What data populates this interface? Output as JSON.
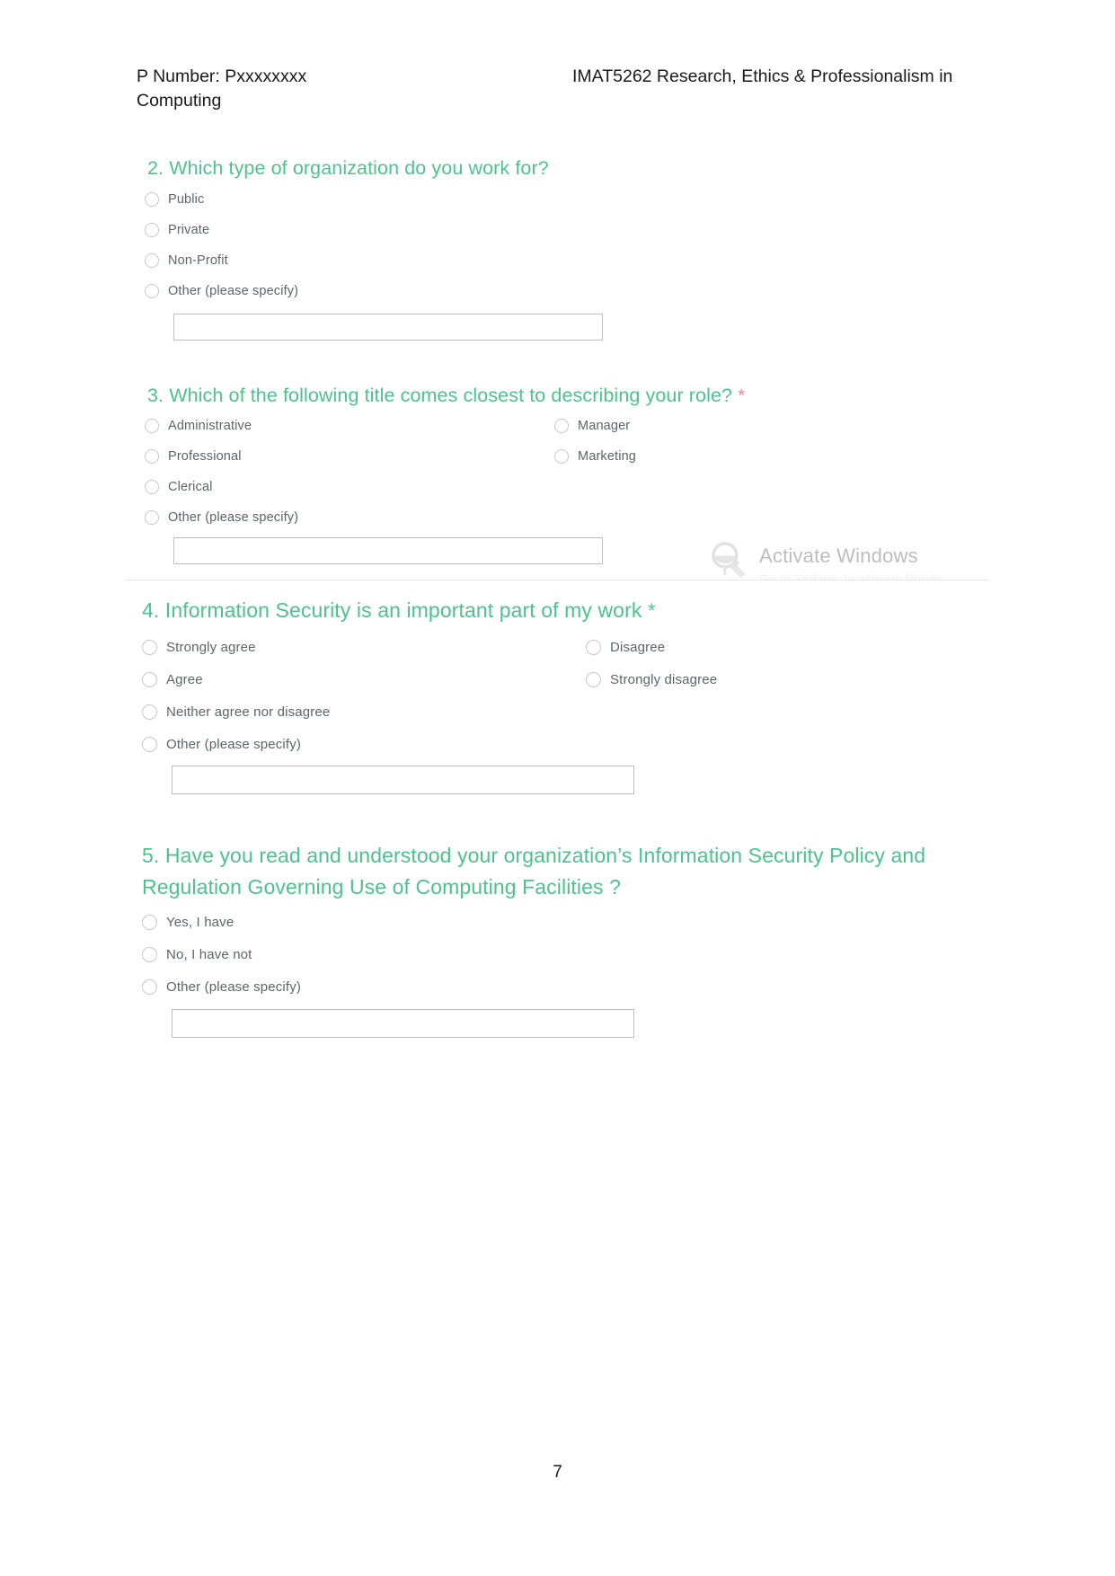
{
  "header": {
    "left": "P Number: Pxxxxxxxx",
    "right": "IMAT5262 Research, Ethics & Professionalism in",
    "wrap": "Computing"
  },
  "questions": [
    {
      "id": "q2",
      "title": "2. Which type of organization do you work for?",
      "required": false,
      "required_mark": "",
      "options_col1": [
        "Public",
        "Private",
        "Non-Profit"
      ],
      "options_col2": [],
      "other_label": "Other (please specify)",
      "other_value": "",
      "other_placeholder": ""
    },
    {
      "id": "q3",
      "title": "3. Which of the following title comes closest to describing your role?",
      "required": true,
      "required_mark": "*",
      "options_col1": [
        "Administrative",
        "Professional",
        "Clerical"
      ],
      "options_col2": [
        "Manager",
        "Marketing"
      ],
      "other_label": "Other (please specify)",
      "other_value": "",
      "other_placeholder": ""
    },
    {
      "id": "q4",
      "title": "4. Information Security is an important part of my work",
      "required": true,
      "required_mark": "*",
      "options_col1": [
        "Strongly agree",
        "Agree",
        "Neither agree nor disagree"
      ],
      "options_col2": [
        "Disagree",
        "Strongly disagree"
      ],
      "other_label": "Other (please specify)",
      "other_value": "",
      "other_placeholder": ""
    },
    {
      "id": "q5",
      "title_line1": "5. Have you read and understood your organization’s Information Security Policy and",
      "title_line2": "Regulation Governing Use of Computing Facilities ?",
      "required": false,
      "required_mark": "",
      "options_col1": [
        "Yes, I have",
        "No, I have not"
      ],
      "options_col2": [],
      "other_label": "Other (please specify)",
      "other_value": "",
      "other_placeholder": ""
    }
  ],
  "watermark": {
    "title": "Activate Windows",
    "subtitle": "Go to Settings to activate Windows."
  },
  "footer": {
    "page_number": "7"
  },
  "colors": {
    "heading_green": "#4ec28d",
    "required_pink": "#f2899b",
    "option_text": "#5c6569",
    "input_border": "#bdc1c4",
    "divider": "#e3e5e7",
    "header_text": "#1a1a1a",
    "watermark_text": "#bdbdbd"
  }
}
